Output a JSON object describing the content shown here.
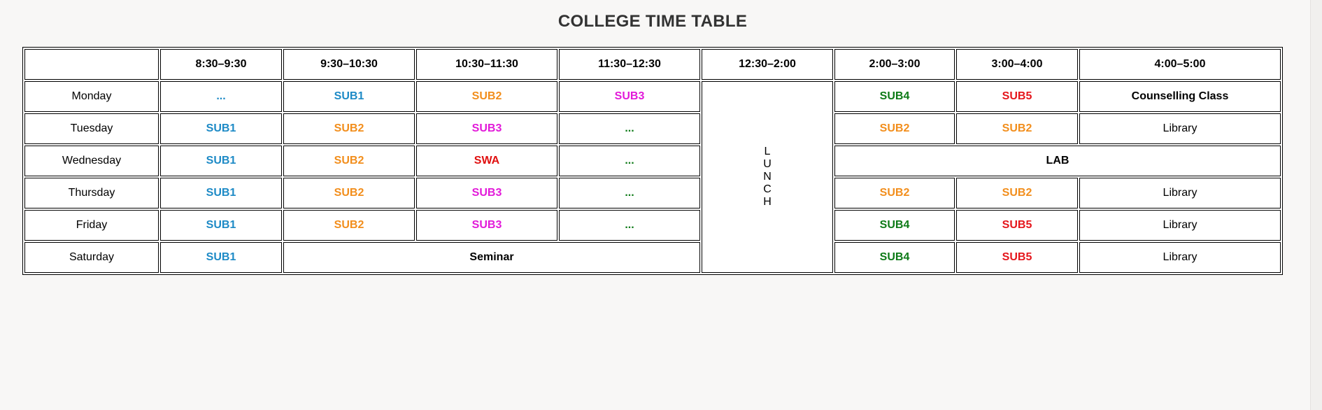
{
  "title": "COLLEGE TIME TABLE",
  "header": {
    "corner": "",
    "slots": [
      "8:30–9:30",
      "9:30–10:30",
      "10:30–11:30",
      "11:30–12:30",
      "12:30–2:00",
      "2:00–3:00",
      "3:00–4:00",
      "4:00–5:00"
    ]
  },
  "lunch_letters": [
    "L",
    "U",
    "N",
    "C",
    "H"
  ],
  "colors": {
    "SUB1": "#1d8ac6",
    "SUB2": "#f28e1c",
    "SUB3": "#e21ad9",
    "SUB4": "#0d7a17",
    "SUB5": "#e5161c"
  },
  "rows": {
    "monday": {
      "day": "Monday",
      "c1": "...",
      "c2": "SUB1",
      "c3": "SUB2",
      "c4": "SUB3",
      "c6": "SUB4",
      "c7": "SUB5",
      "c8": "Counselling Class"
    },
    "tuesday": {
      "day": "Tuesday",
      "c1": "SUB1",
      "c2": "SUB2",
      "c3": "SUB3",
      "c4": "...",
      "c6": "SUB2",
      "c7": "SUB2",
      "c8": "Library"
    },
    "wednesday": {
      "day": "Wednesday",
      "c1": "SUB1",
      "c2": "SUB2",
      "c3": "SWA",
      "c4": "...",
      "lab": "LAB"
    },
    "thursday": {
      "day": "Thursday",
      "c1": "SUB1",
      "c2": "SUB2",
      "c3": "SUB3",
      "c4": "...",
      "c6": "SUB2",
      "c7": "SUB2",
      "c8": "Library"
    },
    "friday": {
      "day": "Friday",
      "c1": "SUB1",
      "c2": "SUB2",
      "c3": "SUB3",
      "c4": "...",
      "c6": "SUB4",
      "c7": "SUB5",
      "c8": "Library"
    },
    "saturday": {
      "day": "Saturday",
      "c1": "SUB1",
      "seminar": "Seminar",
      "c6": "SUB4",
      "c7": "SUB5",
      "c8": "Library"
    }
  }
}
